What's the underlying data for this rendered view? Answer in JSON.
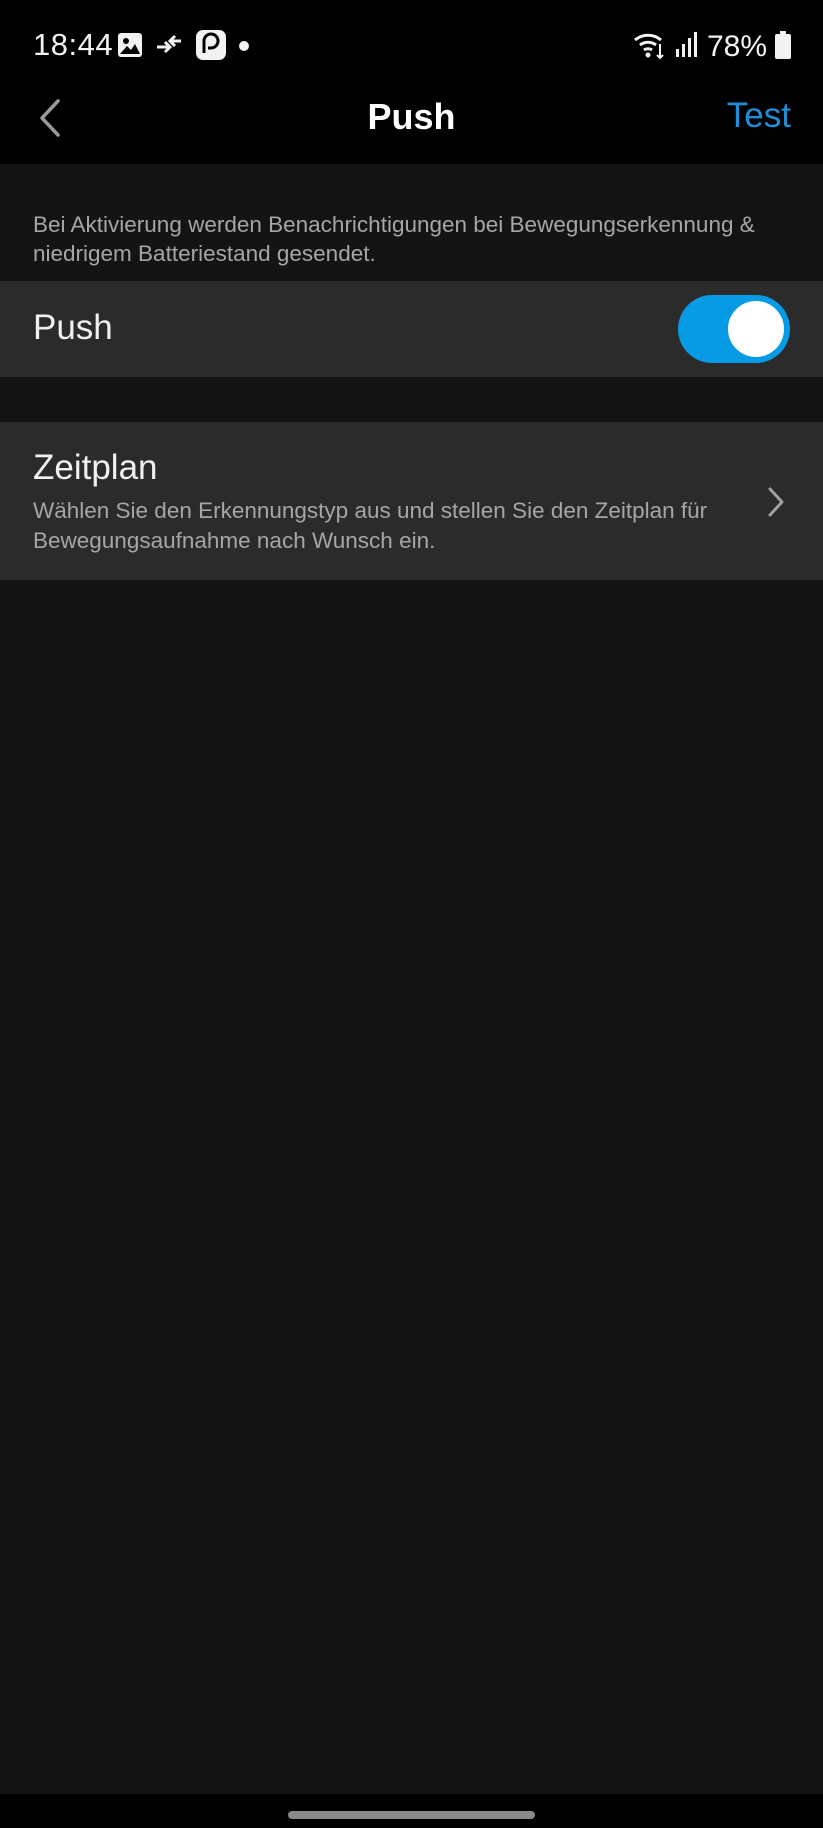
{
  "status_bar": {
    "time": "18:44",
    "battery_percent": "78%",
    "icons_left": [
      "gallery-icon",
      "data-transfer-icon",
      "messenger-icon",
      "notification-dot-icon"
    ],
    "icons_right": [
      "wifi-icon",
      "signal-icon",
      "battery-icon"
    ]
  },
  "header": {
    "title": "Push",
    "action_label": "Test",
    "accent_color": "#1e8fd6"
  },
  "main": {
    "hint": "Bei Aktivierung werden Benachrichtigungen bei Bewegungserkennung & niedrigem Batteriestand gesendet.",
    "push_row": {
      "label": "Push",
      "toggle_on": true,
      "toggle_color": "#079be6"
    },
    "schedule_row": {
      "title": "Zeitplan",
      "description": "Wählen Sie den Erkennungstyp aus und stellen Sie den Zeitplan für Bewegungsaufnahme nach Wunsch ein."
    }
  }
}
